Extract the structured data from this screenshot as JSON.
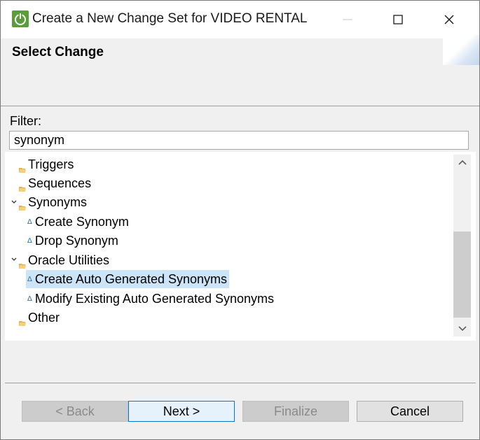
{
  "window": {
    "title": "Create a New Change Set for VIDEO RENTAL"
  },
  "banner": {
    "title": "Select Change"
  },
  "filter": {
    "label": "Filter:",
    "value": "synonym"
  },
  "tree": {
    "items": [
      {
        "label": "Triggers",
        "type": "folder",
        "expanded": false
      },
      {
        "label": "Sequences",
        "type": "folder",
        "expanded": false
      },
      {
        "label": "Synonyms",
        "type": "folder",
        "expanded": true
      },
      {
        "label": "Create Synonym",
        "type": "change"
      },
      {
        "label": "Drop Synonym",
        "type": "change"
      },
      {
        "label": "Oracle Utilities",
        "type": "folder",
        "expanded": true
      },
      {
        "label": "Create Auto Generated Synonyms",
        "type": "change",
        "selected": true
      },
      {
        "label": "Modify Existing Auto Generated Synonyms",
        "type": "change"
      },
      {
        "label": "Other",
        "type": "folder",
        "expanded": false
      }
    ]
  },
  "buttons": {
    "back": "< Back",
    "next": "Next >",
    "finalize": "Finalize",
    "cancel": "Cancel"
  },
  "colors": {
    "selection": "#cce4f7",
    "folder": "#e8b04a",
    "change_icon": "#2a6db0",
    "app_icon": "#5a9e3a",
    "default_button_border": "#0078d7"
  },
  "icons": {
    "app": "power-icon",
    "folder": "folder-open-icon",
    "change": "delta-icon"
  }
}
